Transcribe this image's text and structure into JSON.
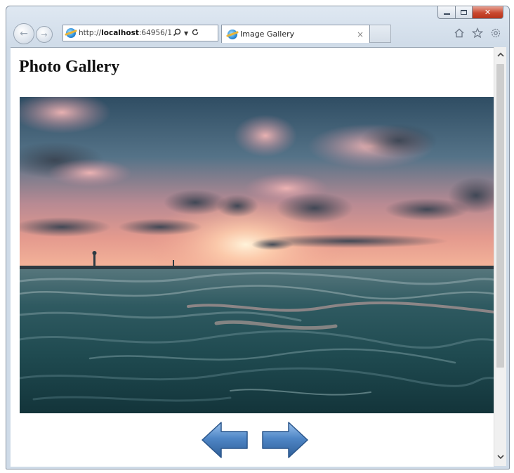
{
  "browser": {
    "address": {
      "url_prefix": "http://",
      "url_host": "localhost",
      "url_rest": ":64956/1",
      "search_icon": "search-icon",
      "refresh_icon": "refresh-icon"
    },
    "tab": {
      "title": "Image Gallery",
      "close": "×"
    },
    "toolbar_icons": [
      "home-icon",
      "favorites-star-icon",
      "settings-gear-icon"
    ]
  },
  "page": {
    "title": "Photo Gallery",
    "image_alt": "Sunset over the ocean waves",
    "controls": {
      "previous_icon": "left-arrow-icon",
      "next_icon": "right-arrow-icon"
    }
  },
  "colors": {
    "arrow_blue": "#4f86c6",
    "arrow_dark": "#2f5f98"
  }
}
